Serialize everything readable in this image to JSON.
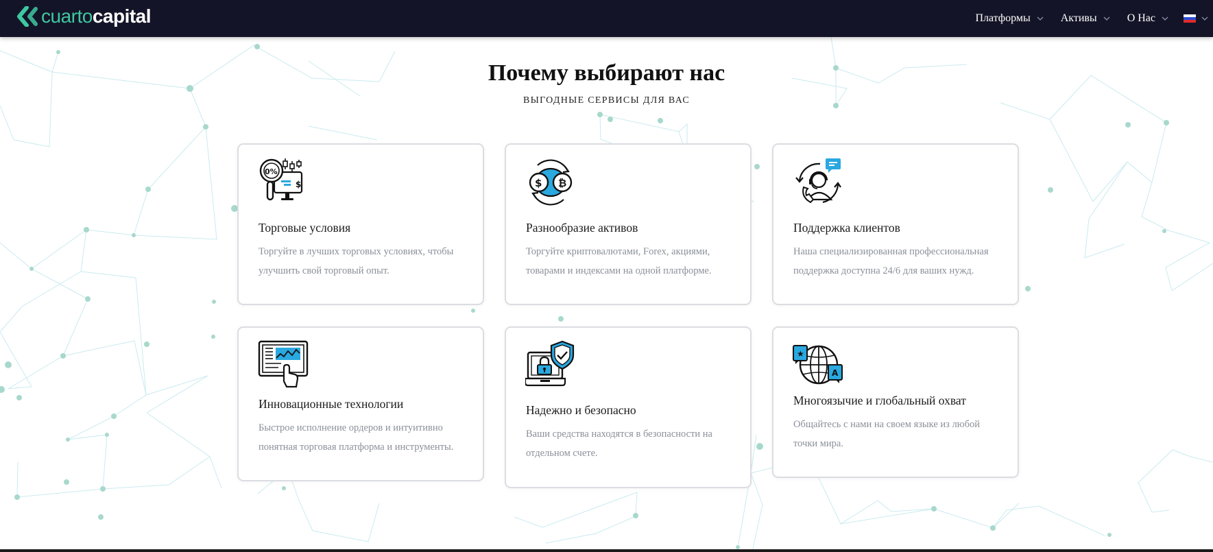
{
  "colors": {
    "header_bg": "#141428",
    "brand_green": "#3ec7a0",
    "accent_blue": "#2aa8e0",
    "card_border": "#dcdde2",
    "muted_text": "#8a8f99"
  },
  "header": {
    "logo": {
      "part1": "cuarto",
      "part2": "capital"
    },
    "nav": [
      {
        "label": "Платформы"
      },
      {
        "label": "Активы"
      },
      {
        "label": "О Нас"
      }
    ],
    "language": {
      "icon": "russian-flag-icon"
    }
  },
  "section": {
    "title": "Почему выбирают нас",
    "subtitle": "ВЫГОДНЫЕ СЕРВИСЫ ДЛЯ ВАС"
  },
  "cards": [
    {
      "icon": "trading-conditions-icon",
      "title": "Торговые условия",
      "text": "Торгуйте в лучших торговых условиях, чтобы улучшить свой торговый опыт."
    },
    {
      "icon": "asset-variety-icon",
      "title": "Разнообразие активов",
      "text": "Торгуйте криптовалютами, Forex, акциями, товарами и индексами на одной платформе."
    },
    {
      "icon": "customer-support-icon",
      "title": "Поддержка клиентов",
      "text": "Наша специализированная профессиональная поддержка доступна 24/6 для ваших нужд."
    },
    {
      "icon": "innovative-tech-icon",
      "title": "Инновационные технологии",
      "text": "Быстрое исполнение ордеров и интуитивно понятная торговая платформа и инструменты."
    },
    {
      "icon": "security-icon",
      "title": "Надежно и безопасно",
      "text": "Ваши средства находятся в безопасности на отдельном счете."
    },
    {
      "icon": "multilingual-icon",
      "title": "Многоязычие и глобальный охват",
      "text": "Общайтесь с нами на своем языке из любой точки мира."
    }
  ]
}
